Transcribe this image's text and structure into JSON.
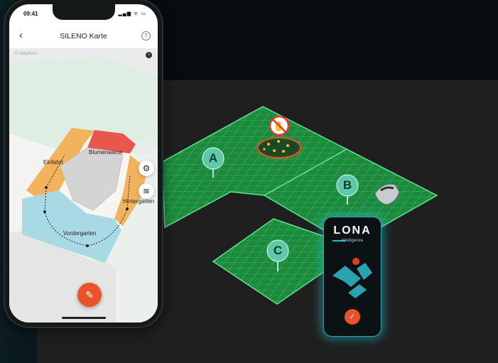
{
  "app": {
    "status_time": "09:41",
    "status_icons": "▂▄▆ ᯤ ▭",
    "title": "SILENO Karte",
    "back_icon": "‹",
    "help_icon": "?",
    "map_attribution": "© mapbox",
    "info_icon": "i",
    "zones": {
      "blumenwiese": "Blumenwiese",
      "einfahrt": "Einfahrt",
      "hintergarten": "Hintergarten",
      "vordergarten": "Vordergarten"
    },
    "settings_icon": "⚙",
    "layers_icon": "≋",
    "edit_icon": "✎"
  },
  "scene": {
    "zone_a": "A",
    "zone_b": "B",
    "zone_c": "C",
    "no_mow_icon": "no-mow-icon"
  },
  "lona": {
    "logo": "LONA",
    "subtitle": "Intelligence",
    "check_icon": "✓"
  },
  "colors": {
    "grass": "#1f8a3c",
    "grid": "#79e39a",
    "accent": "#e8532a",
    "teal": "#2aa3b1"
  }
}
